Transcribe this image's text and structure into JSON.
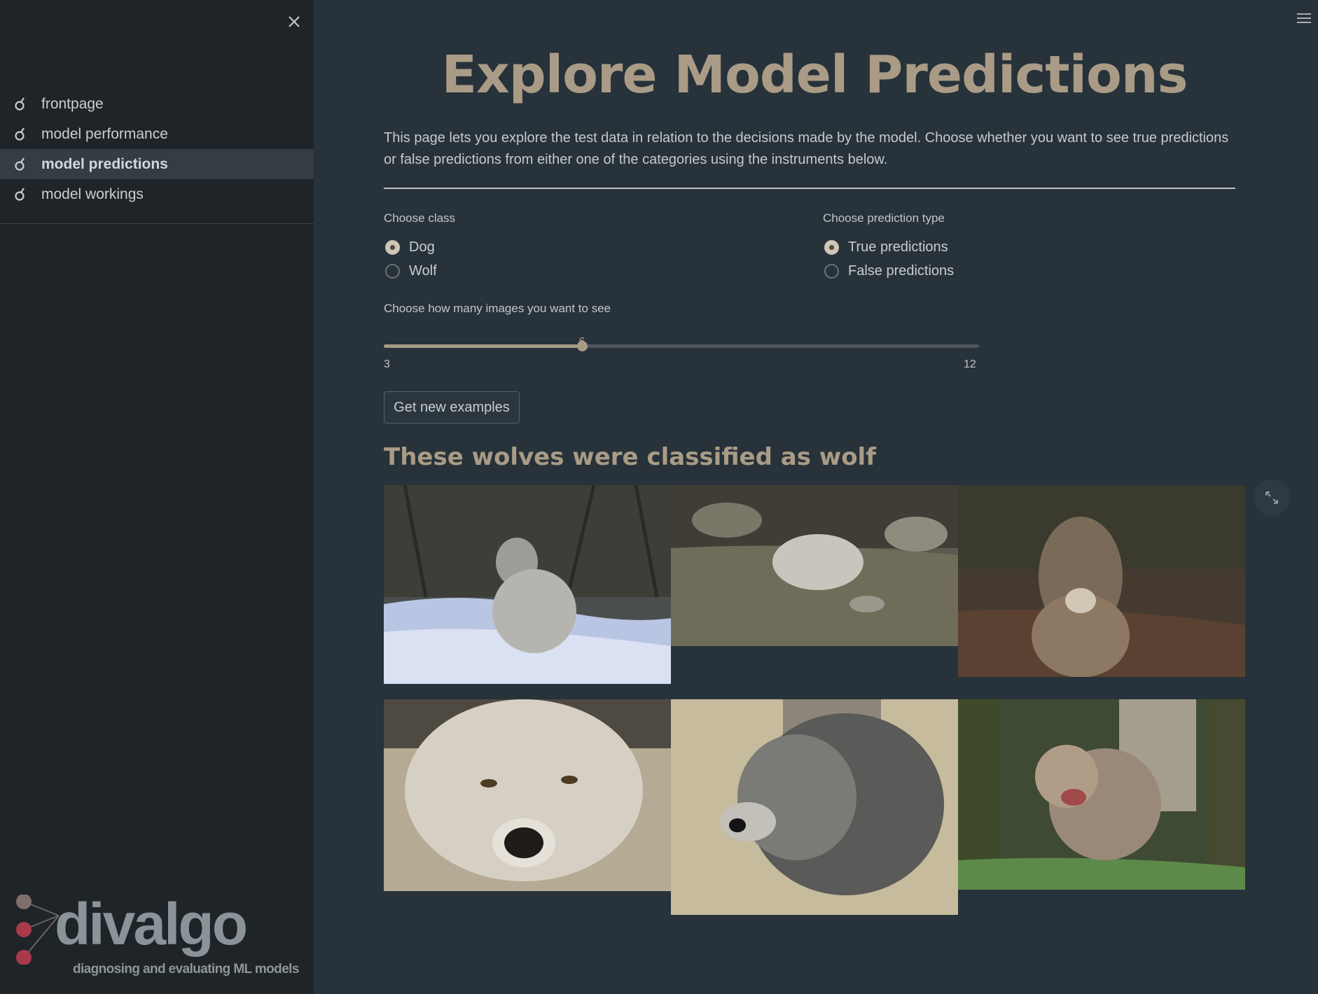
{
  "sidebar": {
    "nav_items": [
      {
        "label": "frontpage",
        "active": false
      },
      {
        "label": "model performance",
        "active": false
      },
      {
        "label": "model predictions",
        "active": true
      },
      {
        "label": "model workings",
        "active": false
      }
    ],
    "logo": {
      "text": "divalgo",
      "subtitle": "diagnosing and evaluating ML models"
    }
  },
  "main": {
    "title": "Explore Model Predictions",
    "intro": "This page lets you explore the test data in relation to the decisions made by the model. Choose whether you want to see true predictions or false predictions from either one of the categories using the instruments below.",
    "class_label": "Choose class",
    "class_options": [
      {
        "label": "Dog",
        "checked": true
      },
      {
        "label": "Wolf",
        "checked": false
      }
    ],
    "prediction_label": "Choose prediction type",
    "prediction_options": [
      {
        "label": "True predictions",
        "checked": true
      },
      {
        "label": "False predictions",
        "checked": false
      }
    ],
    "slider": {
      "label": "Choose how many images you want to see",
      "min": 3,
      "max": 12,
      "value": 6,
      "min_text": "3",
      "max_text": "12",
      "value_text": "6"
    },
    "button_label": "Get new examples",
    "results_heading": "These wolves were classified as wolf"
  },
  "colors": {
    "accent": "#a99b85",
    "background": "#27323a",
    "sidebar": "#1e2428"
  }
}
